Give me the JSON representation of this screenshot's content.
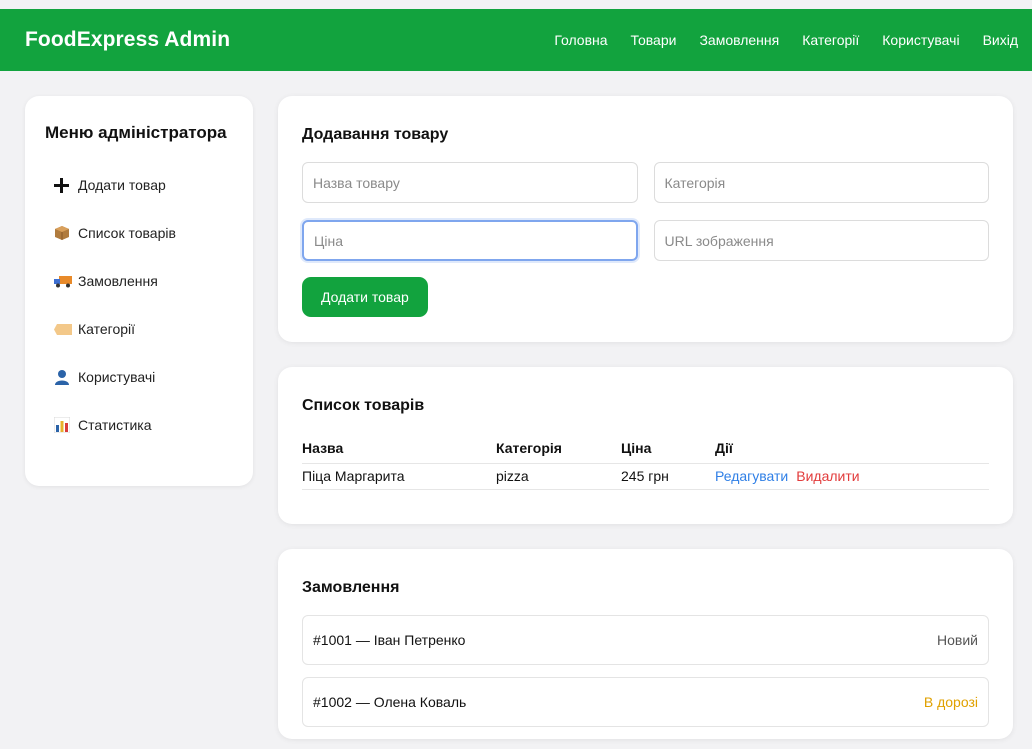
{
  "header": {
    "brand": "FoodExpress Admin",
    "nav": [
      "Головна",
      "Товари",
      "Замовлення",
      "Категорії",
      "Користувачі",
      "Вихід"
    ],
    "color": "#12a33e"
  },
  "sidebar": {
    "title": "Меню адміністратора",
    "items": [
      {
        "icon": "plus-icon",
        "label": "Додати товар"
      },
      {
        "icon": "package-icon",
        "label": "Список товарів"
      },
      {
        "icon": "delivery-truck-icon",
        "label": "Замовлення"
      },
      {
        "icon": "label-tag-icon",
        "label": "Категорії"
      },
      {
        "icon": "user-icon",
        "label": "Користувачі"
      },
      {
        "icon": "bar-chart-icon",
        "label": "Статистика"
      }
    ]
  },
  "add_product": {
    "title": "Додавання товару",
    "name_placeholder": "Назва товару",
    "category_placeholder": "Категорія",
    "price_placeholder": "Ціна",
    "image_placeholder": "URL зображення",
    "submit_label": "Додати товар"
  },
  "product_list": {
    "title": "Список товарів",
    "columns": [
      "Назва",
      "Категорія",
      "Ціна",
      "Дії"
    ],
    "rows": [
      {
        "name": "Піца Маргарита",
        "category": "pizza",
        "price": "245 грн",
        "edit": "Редагувати",
        "delete": "Видалити"
      }
    ]
  },
  "orders": {
    "title": "Замовлення",
    "items": [
      {
        "label": "#1001 — Іван Петренко",
        "status": "Новий",
        "status_color": "#555555"
      },
      {
        "label": "#1002 — Олена Коваль",
        "status": "В дорозі",
        "status_color": "#e0a100"
      }
    ]
  }
}
